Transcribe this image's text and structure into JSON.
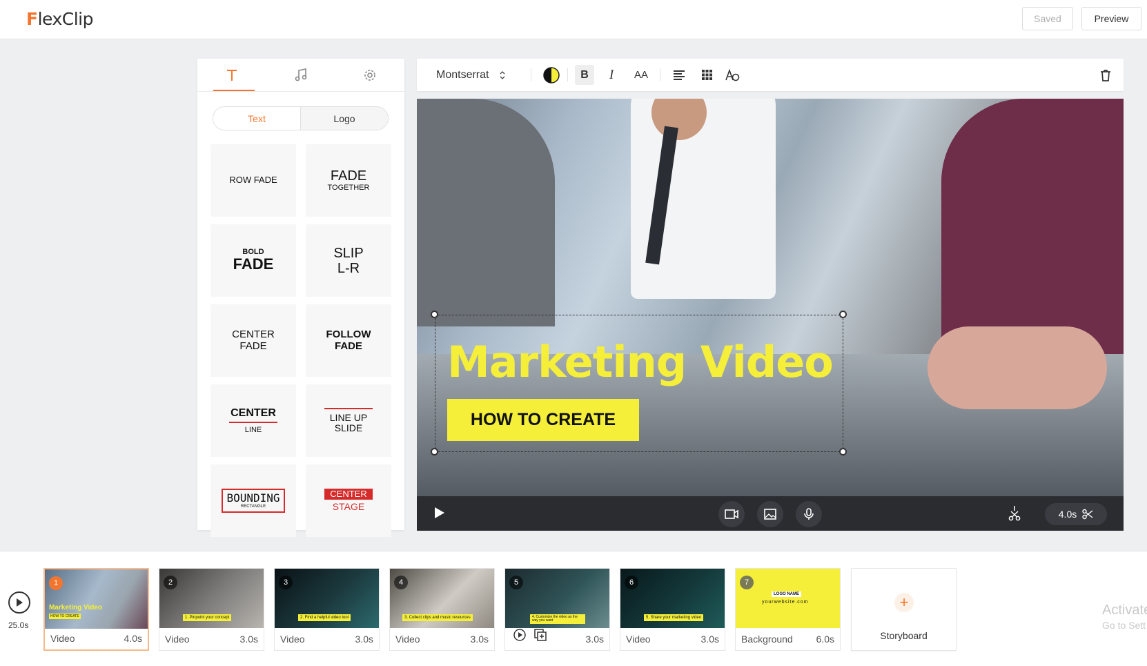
{
  "app": {
    "name": "FlexClip",
    "logo_first": "F",
    "logo_rest": "lexClip"
  },
  "topbar": {
    "saved_label": "Saved",
    "preview_label": "Preview"
  },
  "left_panel": {
    "tabs": [
      {
        "icon": "text-icon"
      },
      {
        "icon": "music-icon"
      },
      {
        "icon": "settings-icon"
      }
    ],
    "segment": {
      "text_label": "Text",
      "logo_label": "Logo",
      "active": "Text"
    },
    "tiles": [
      {
        "l1": "ROW FADE",
        "l2": ""
      },
      {
        "l1": "FADE",
        "l2": "TOGETHER"
      },
      {
        "l1": "BOLD",
        "l2": "FADE"
      },
      {
        "l1": "SLIP",
        "l2": "L-R"
      },
      {
        "l1": "CENTER",
        "l2": "FADE"
      },
      {
        "l1": "FOLLOW",
        "l2": "FADE"
      },
      {
        "l1": "CENTER",
        "l2": "LINE"
      },
      {
        "l1": "LINE UP",
        "l2": "SLIDE"
      },
      {
        "l1": "BOUNDING",
        "l2": "RECTANGLE"
      },
      {
        "l1": "CENTER",
        "l2": "STAGE"
      }
    ]
  },
  "text_toolbar": {
    "font": "Montserrat",
    "bold_glyph": "B",
    "italic_glyph": "I",
    "size_glyph": "AA",
    "icons": [
      "font-select-arrows-icon",
      "color-contrast-icon",
      "bold-icon",
      "italic-icon",
      "font-size-icon",
      "align-left-icon",
      "grid-icon",
      "text-style-icon",
      "trash-icon"
    ]
  },
  "canvas": {
    "title": "Marketing Video",
    "subtitle": "HOW TO CREATE",
    "accent_color": "#f5ef3a"
  },
  "controls": {
    "duration": "4.0s"
  },
  "timeline": {
    "total": "25.0s",
    "clips": [
      {
        "num": "1",
        "label": "Video",
        "dur": "4.0s",
        "caption": "Marketing Video",
        "active": true
      },
      {
        "num": "2",
        "label": "Video",
        "dur": "3.0s",
        "caption": "1. Pinpoint your concept"
      },
      {
        "num": "3",
        "label": "Video",
        "dur": "3.0s",
        "caption": "2. Find a helpful video tool"
      },
      {
        "num": "4",
        "label": "Video",
        "dur": "3.0s",
        "caption": "3. Collect clips and music resources"
      },
      {
        "num": "5",
        "label": "",
        "dur": "3.0s",
        "caption": "4. Customize the video as the way you want"
      },
      {
        "num": "6",
        "label": "Video",
        "dur": "3.0s",
        "caption": "5. Share your marketing video"
      },
      {
        "num": "7",
        "label": "Background",
        "dur": "6.0s",
        "logo_name": "LOGO NAME",
        "website": "yourwebsite.com"
      }
    ],
    "storyboard_label": "Storyboard",
    "thumb_title_small": "HOW TO CREATE"
  },
  "watermark": {
    "line1": "Activate",
    "line2": "Go to Sett"
  },
  "colors": {
    "brand": "#f4762e",
    "dark_bar": "#2a2c30",
    "yellow": "#f5ef3a"
  }
}
